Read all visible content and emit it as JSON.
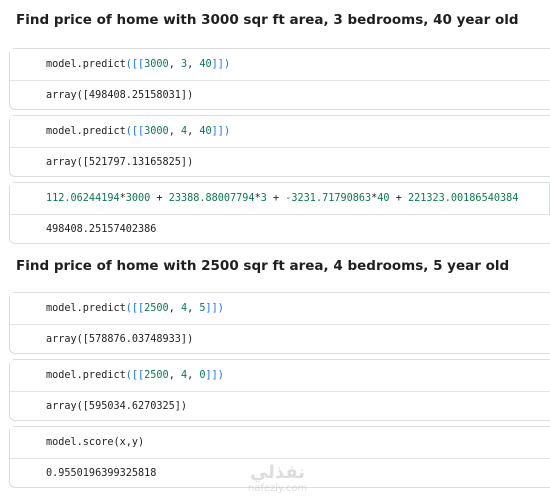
{
  "sections": [
    {
      "heading": "Find price of home with 3000 sqr ft area, 3 bedrooms, 40 year old"
    },
    {
      "heading": "Find price of home with 2500 sqr ft area, 4 bedrooms, 5 year old"
    }
  ],
  "cells": [
    {
      "code": {
        "fn": "model.predict",
        "open": "([[",
        "a": "3000",
        "s1": ", ",
        "b": "3",
        "s2": ", ",
        "c": "40",
        "close": "]])"
      },
      "output": "array([498408.25158031])"
    },
    {
      "code": {
        "fn": "model.predict",
        "open": "([[",
        "a": "3000",
        "s1": ", ",
        "b": "4",
        "s2": ", ",
        "c": "40",
        "close": "]])"
      },
      "output": "array([521797.13165825])"
    },
    {
      "code_line": {
        "t1": "112.06244194",
        "t2": "*",
        "t3": "3000",
        "t4": " + ",
        "t5": "23388.88007794",
        "t6": "*",
        "t7": "3",
        "t8": " + ",
        "t9": "-3231.71790863",
        "t10": "*",
        "t11": "40",
        "t12": " + ",
        "t13": "221323.00186540384"
      },
      "output": "498408.25157402386"
    },
    {
      "code": {
        "fn": "model.predict",
        "open": "([[",
        "a": "2500",
        "s1": ", ",
        "b": "4",
        "s2": ", ",
        "c": "5",
        "close": "]])"
      },
      "output": "array([578876.03748933])"
    },
    {
      "code": {
        "fn": "model.predict",
        "open": "([[",
        "a": "2500",
        "s1": ", ",
        "b": "4",
        "s2": ", ",
        "c": "0",
        "close": "]])"
      },
      "output": "array([595034.6270325])"
    },
    {
      "code_score": {
        "fn": "model.score",
        "args": "(x,y)"
      },
      "output": "0.9550196399325818"
    }
  ],
  "watermark": {
    "line1": "نفذلي",
    "line2": "nafezly.com"
  }
}
